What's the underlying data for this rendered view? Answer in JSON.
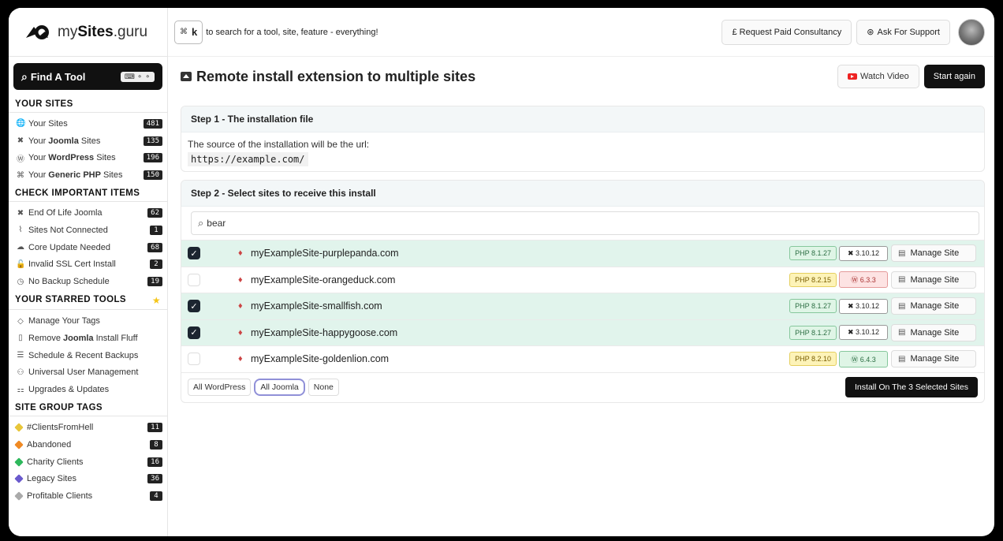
{
  "brand": {
    "name_prefix": "my",
    "name_bold": "Sites",
    "name_suffix": ".guru"
  },
  "find_tool": {
    "label": "Find A Tool",
    "kbd": "⌨ ⚬ ⚬"
  },
  "sidebar": {
    "your_sites": {
      "title": "YOUR SITES",
      "items": [
        {
          "pre": "Your Sites",
          "bold": "",
          "post": "",
          "count": "481",
          "icon": "globe-icon",
          "glyph": "🌐"
        },
        {
          "pre": "Your ",
          "bold": "Joomla",
          "post": " Sites",
          "count": "135",
          "icon": "joomla-icon",
          "glyph": "✖"
        },
        {
          "pre": "Your ",
          "bold": "WordPress",
          "post": " Sites",
          "count": "196",
          "icon": "wordpress-icon",
          "glyph": "Ⓦ"
        },
        {
          "pre": "Your ",
          "bold": "Generic PHP",
          "post": " Sites",
          "count": "150",
          "icon": "php-icon",
          "glyph": "⌘"
        }
      ]
    },
    "check_items": {
      "title": "CHECK IMPORTANT ITEMS",
      "items": [
        {
          "label": "End Of Life Joomla",
          "count": "62",
          "icon": "joomla-icon",
          "glyph": "✖"
        },
        {
          "label": "Sites Not Connected",
          "count": "1",
          "icon": "wifi-off-icon",
          "glyph": "⌇"
        },
        {
          "label": "Core Update Needed",
          "count": "68",
          "icon": "cloud-upload-icon",
          "glyph": "☁"
        },
        {
          "label": "Invalid SSL Cert Install",
          "count": "2",
          "icon": "lock-icon",
          "glyph": "🔓"
        },
        {
          "label": "No Backup Schedule",
          "count": "19",
          "icon": "clock-icon",
          "glyph": "◷"
        }
      ]
    },
    "starred": {
      "title": "YOUR STARRED TOOLS",
      "items": [
        {
          "pre": "Manage Your Tags",
          "bold": "",
          "post": "",
          "icon": "tag-icon",
          "glyph": "◇"
        },
        {
          "pre": "Remove ",
          "bold": "Joomla",
          "post": " Install Fluff",
          "icon": "file-remove-icon",
          "glyph": "▯"
        },
        {
          "pre": "Schedule & Recent Backups",
          "bold": "",
          "post": "",
          "icon": "database-icon",
          "glyph": "☰"
        },
        {
          "pre": "Universal User Management",
          "bold": "",
          "post": "",
          "icon": "users-icon",
          "glyph": "⚇"
        },
        {
          "pre": "Upgrades & Updates",
          "bold": "",
          "post": "",
          "icon": "sitemap-icon",
          "glyph": "⚏"
        }
      ]
    },
    "tags": {
      "title": "SITE GROUP TAGS",
      "items": [
        {
          "label": "#ClientsFromHell",
          "count": "11",
          "color": "#e8c63a"
        },
        {
          "label": "Abandoned",
          "count": "8",
          "color": "#f08a24"
        },
        {
          "label": "Charity Clients",
          "count": "16",
          "color": "#2eb85c"
        },
        {
          "label": "Legacy Sites",
          "count": "36",
          "color": "#6a5acd"
        },
        {
          "label": "Profitable Clients",
          "count": "4",
          "color": "#aaaaaa"
        }
      ]
    }
  },
  "topbar": {
    "kbd_cmd": "⌘",
    "kbd_key": "k",
    "search_hint": "to search for a tool, site, feature - everything!",
    "consult": "£ Request Paid Consultancy",
    "support": "Ask For Support"
  },
  "header": {
    "title": "Remote install extension to multiple sites",
    "watch": "Watch Video",
    "start": "Start again"
  },
  "step1": {
    "title": "Step 1 - The installation file",
    "source": "The source of the installation will be the url:",
    "url": "https://example.com/"
  },
  "step2": {
    "title": "Step 2 - Select sites to receive this install",
    "search_value": "bear",
    "sites": [
      {
        "name": "myExampleSite-purplepanda.com",
        "checked": true,
        "php": "PHP 8.1.27",
        "php_color": "g",
        "cms": "✖ 3.10.12",
        "cms_color": "",
        "manage": "Manage Site"
      },
      {
        "name": "myExampleSite-orangeduck.com",
        "checked": false,
        "php": "PHP 8.2.15",
        "php_color": "y",
        "cms": "Ⓦ 6.3.3",
        "cms_color": "wp",
        "manage": "Manage Site"
      },
      {
        "name": "myExampleSite-smallfish.com",
        "checked": true,
        "php": "PHP 8.1.27",
        "php_color": "g",
        "cms": "✖ 3.10.12",
        "cms_color": "",
        "manage": "Manage Site"
      },
      {
        "name": "myExampleSite-happygoose.com",
        "checked": true,
        "php": "PHP 8.1.27",
        "php_color": "g",
        "cms": "✖ 3.10.12",
        "cms_color": "",
        "manage": "Manage Site"
      },
      {
        "name": "myExampleSite-goldenlion.com",
        "checked": false,
        "php": "PHP 8.2.10",
        "php_color": "y",
        "cms": "Ⓦ 6.4.3",
        "cms_color": "wpg",
        "manage": "Manage Site"
      }
    ],
    "filters": [
      "All WordPress",
      "All Joomla",
      "None"
    ],
    "active_filter": "All Joomla",
    "install_label": "Install On The 3 Selected Sites"
  }
}
